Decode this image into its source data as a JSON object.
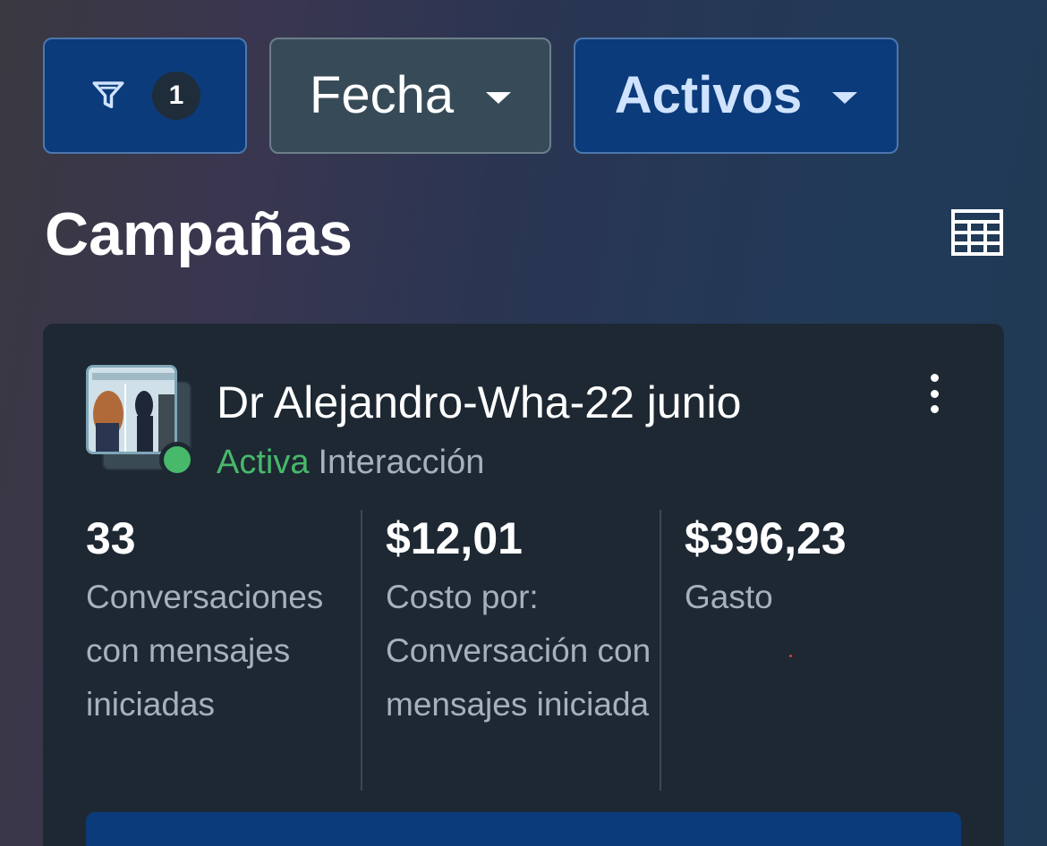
{
  "filters": {
    "filter_count": "1",
    "date_label": "Fecha",
    "status_label": "Activos"
  },
  "page": {
    "title": "Campañas"
  },
  "campaign": {
    "name": "Dr Alejandro-Wha-22 junio",
    "status": "Activa",
    "objective": "Interacción",
    "status_color": "#48b86a",
    "metrics": [
      {
        "value": "33",
        "label": "Conversaciones con mensajes iniciadas"
      },
      {
        "value": "$12,01",
        "label": "Costo por: Conversación con mensajes iniciada"
      },
      {
        "value": "$396,23",
        "label": "Gasto"
      }
    ]
  },
  "colors": {
    "accent_blue": "#0b3b7a",
    "card_bg": "#1d2833",
    "muted_text": "#a6b1bb"
  }
}
